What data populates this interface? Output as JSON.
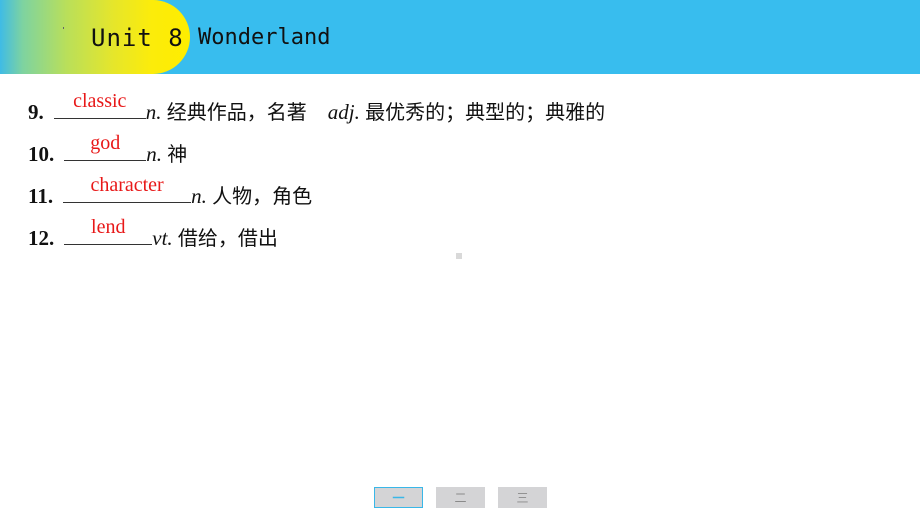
{
  "header": {
    "unit": "Unit 8",
    "title": "Wonderland",
    "colors": {
      "bar": "#38bdee",
      "pill_start": "#7ed3a0",
      "pill_end": "#feed00"
    }
  },
  "items": [
    {
      "number": "9",
      "answer": "classic",
      "definition_parts": [
        {
          "pos": "n.",
          "meaning": "经典作品，名著"
        },
        {
          "pos": "adj.",
          "meaning": "最优秀的；典型的；典雅的"
        }
      ]
    },
    {
      "number": "10",
      "answer": "god",
      "definition_parts": [
        {
          "pos": "n.",
          "meaning": "神"
        }
      ]
    },
    {
      "number": "11",
      "answer": "character",
      "definition_parts": [
        {
          "pos": "n.",
          "meaning": "人物，角色"
        }
      ]
    },
    {
      "number": "12",
      "answer": "lend",
      "definition_parts": [
        {
          "pos": "vt.",
          "meaning": "借给，借出"
        }
      ]
    }
  ],
  "answer_color": "#e81818",
  "pager": {
    "tabs": [
      {
        "label": "一",
        "active": true
      },
      {
        "label": "二",
        "active": false
      },
      {
        "label": "三",
        "active": false
      }
    ],
    "active_color": "#39b7e8"
  }
}
